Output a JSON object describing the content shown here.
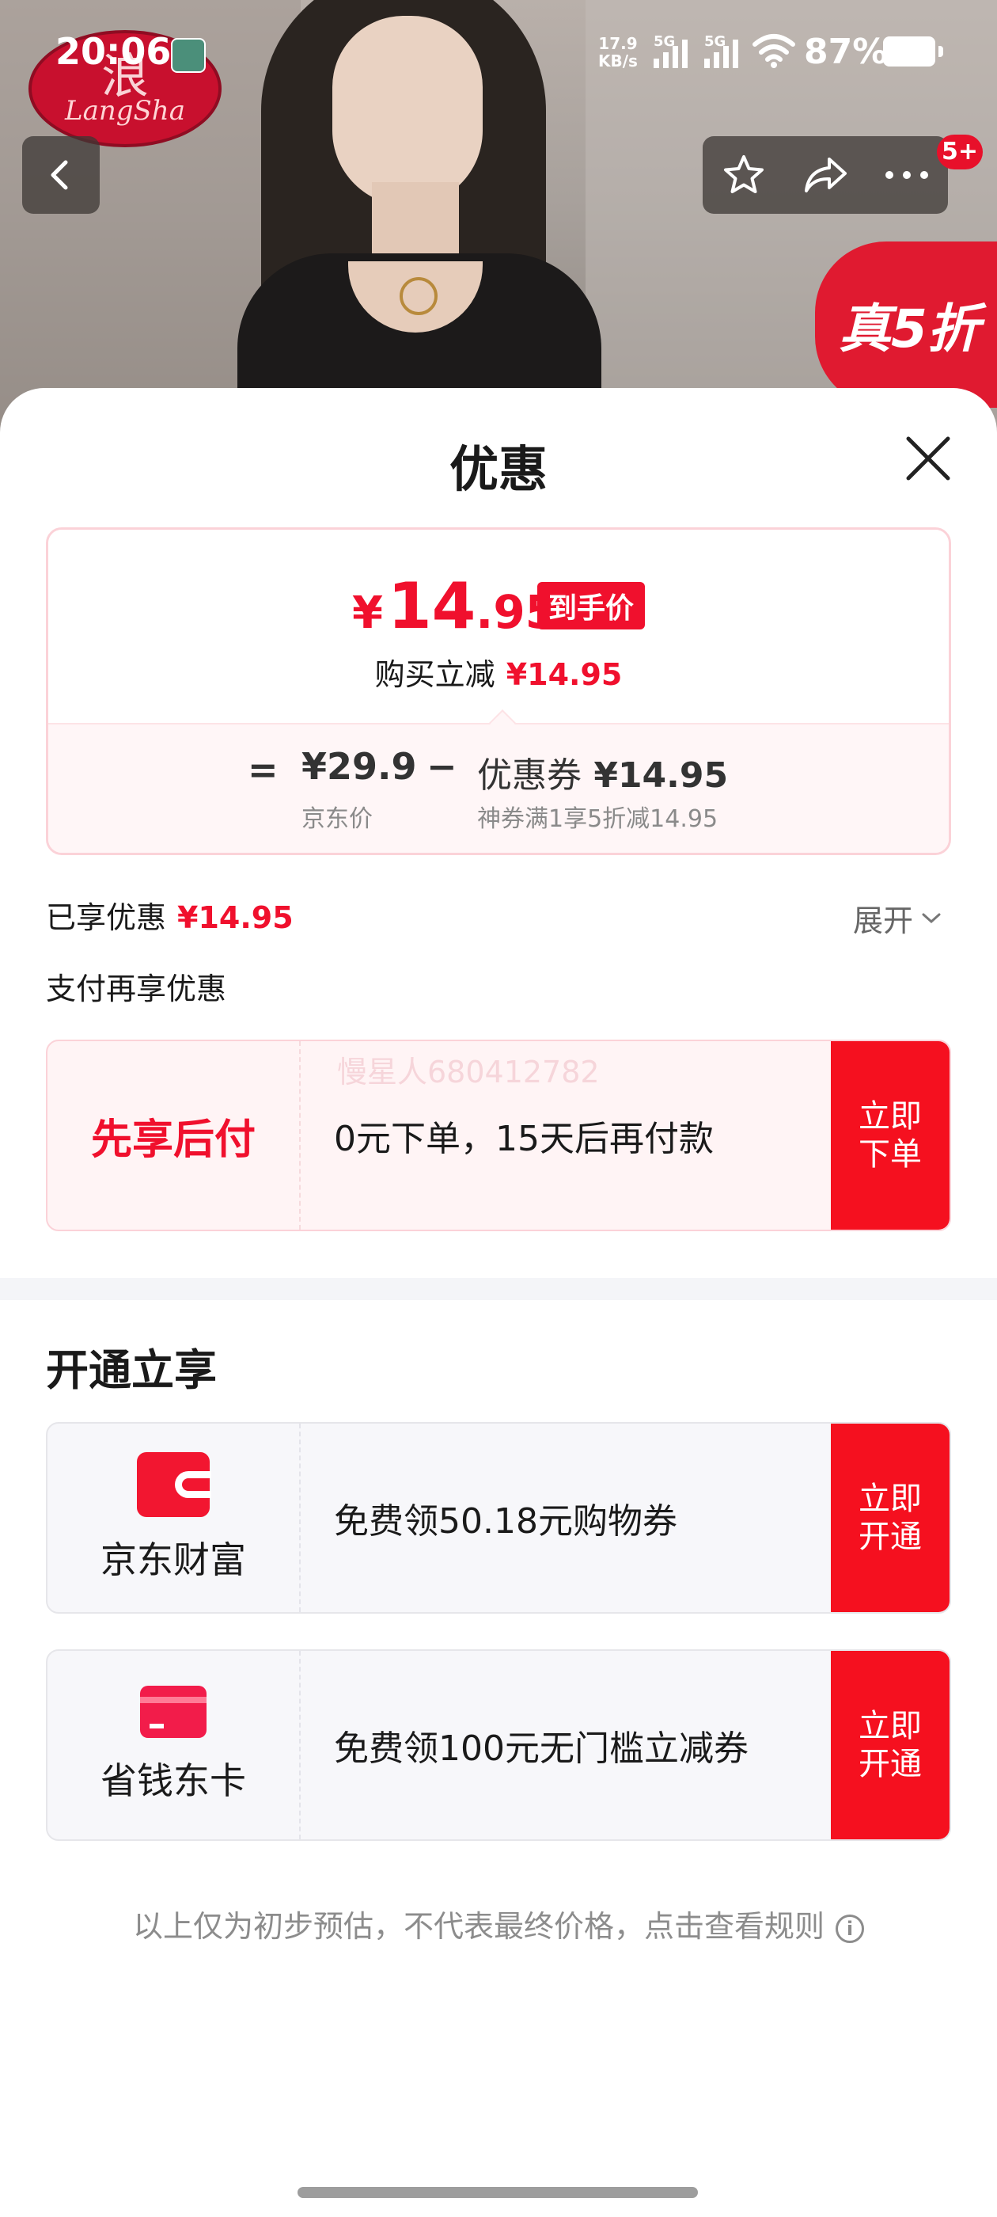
{
  "status_bar": {
    "time": "20:06",
    "net_speed_value": "17.9",
    "net_speed_unit": "KB/s",
    "signal_1": "5G",
    "signal_2": "5G",
    "battery": "87%"
  },
  "hero": {
    "brand_script": "LangSha",
    "promo_tag": "真5折",
    "message_badge": "5+"
  },
  "sheet": {
    "title": "优惠"
  },
  "price_card": {
    "currency": "¥",
    "final_int": "14",
    "final_dec": ".95",
    "final_tag": "到手价",
    "reduce_label": "购买立减",
    "reduce_amount": "¥14.95",
    "equals": "=",
    "original_price": "¥29.9",
    "original_label": "京东价",
    "minus": "−",
    "coupon_name": "优惠券",
    "coupon_value": "¥14.95",
    "coupon_detail": "神券满1享5折减14.95"
  },
  "enjoyed": {
    "label": "已享优惠",
    "amount": "¥14.95",
    "expand_label": "展开"
  },
  "pay_more": {
    "label": "支付再享优惠"
  },
  "bnpl": {
    "name": "先享后付",
    "description": "0元下单，15天后再付款",
    "watermark": "慢星人680412782",
    "cta": "立即\n下单"
  },
  "open_section": {
    "title": "开通立享",
    "items": [
      {
        "name": "京东财富",
        "description": "免费领50.18元购物券",
        "cta": "立即\n开通",
        "icon": "wallet-icon"
      },
      {
        "name": "省钱东卡",
        "description": "免费领100元无门槛立减券",
        "cta": "立即\n开通",
        "icon": "card-icon"
      }
    ]
  },
  "disclaimer": "以上仅为初步预估，不代表最终价格，点击查看规则",
  "colors": {
    "accent_red": "#f0102d",
    "cta_red": "#f5101f"
  }
}
